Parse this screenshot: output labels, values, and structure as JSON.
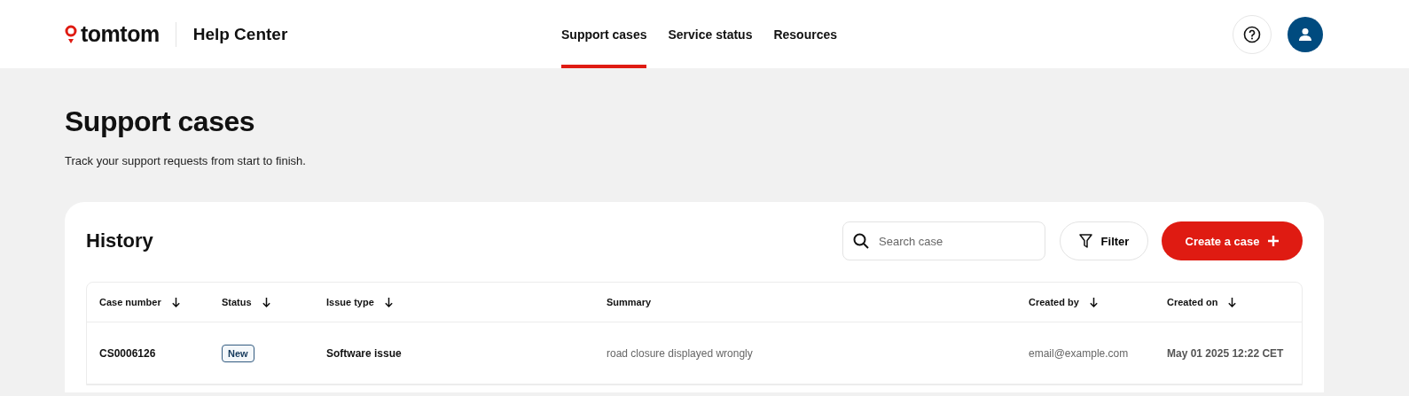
{
  "header": {
    "logo_text": "tomtom",
    "product": "Help Center",
    "nav": [
      {
        "label": "Support cases",
        "selected": true
      },
      {
        "label": "Service status",
        "selected": false
      },
      {
        "label": "Resources",
        "selected": false
      }
    ]
  },
  "page": {
    "title": "Support cases",
    "subtitle": "Track your support requests from start to finish."
  },
  "history": {
    "title": "History",
    "search": {
      "placeholder": "Search case"
    },
    "filter_button": "Filter",
    "create_button": "Create a case",
    "table": {
      "columns": [
        {
          "label": "Case number",
          "sortable": true
        },
        {
          "label": "Status",
          "sortable": true
        },
        {
          "label": "Issue type",
          "sortable": true
        },
        {
          "label": "Summary",
          "sortable": false
        },
        {
          "label": "Created by",
          "sortable": true
        },
        {
          "label": "Created on",
          "sortable": true
        }
      ],
      "rows": [
        {
          "case_number": "CS0006126",
          "status": "New",
          "issue_type": "Software issue",
          "summary": "road closure displayed wrongly",
          "created_by": "email@example.com",
          "created_on": "May 01 2025 12:22 CET"
        }
      ]
    }
  }
}
